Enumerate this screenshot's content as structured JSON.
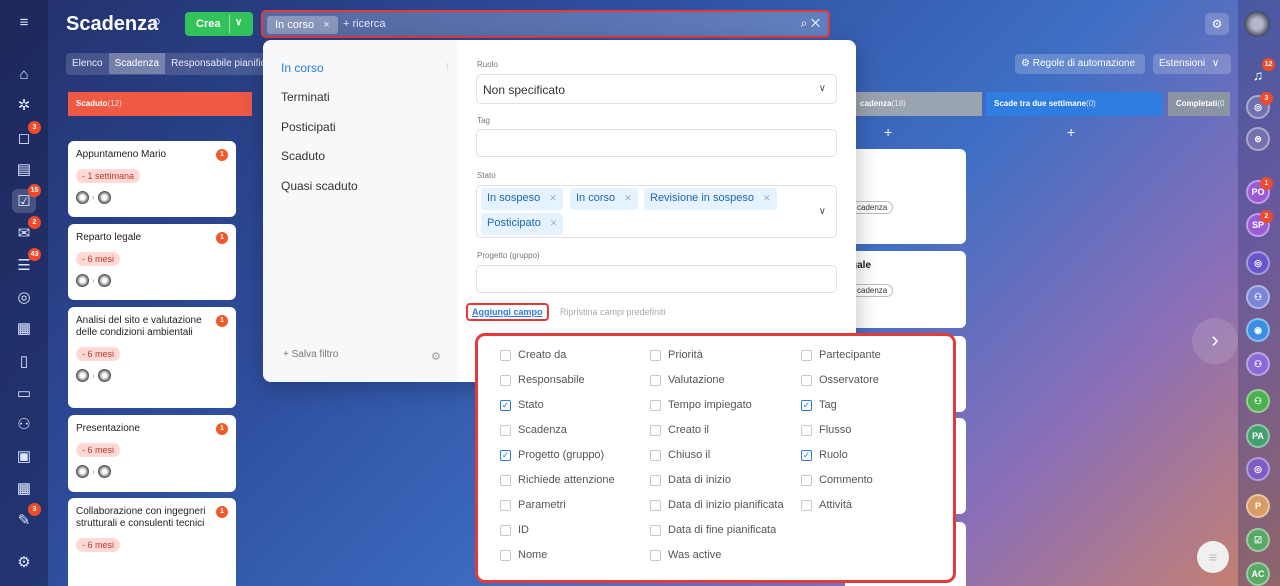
{
  "app_title": "Scadenza",
  "create_label": "Crea",
  "search": {
    "chip": "In corso",
    "placeholder": "+ ricerca"
  },
  "view_tabs": [
    "Elenco",
    "Scadenza",
    "Responsabile pianific"
  ],
  "automation_label": "Regole di automazione",
  "extensions_label": "Estensioni",
  "columns": [
    {
      "name": "Scaduto",
      "count": "(12)",
      "color": "#ef5a45"
    },
    {
      "name": "cadenza",
      "count": "(18)",
      "color": "#9aa3b0"
    },
    {
      "name": "Scade tra due settimane",
      "count": "(0)",
      "color": "#2f7de1"
    },
    {
      "name": "Completati",
      "count": "(0",
      "color": "#8a94a3"
    }
  ],
  "cards": [
    {
      "title": "Appuntameno Mario",
      "badge": "1",
      "deadline": "- 1 settimana"
    },
    {
      "title": "Reparto legale",
      "badge": "1",
      "deadline": "- 6 mesi"
    },
    {
      "title": "Analisi del sito e valutazione delle condizioni ambientali",
      "badge": "1",
      "deadline": "- 6 mesi"
    },
    {
      "title": "Presentazione",
      "badge": "1",
      "deadline": "- 6 mesi"
    },
    {
      "title": "Collaborazione con ingegneri strutturali e consulenti tecnici",
      "badge": "1",
      "deadline": "- 6 mesi"
    }
  ],
  "right_cards": [
    {
      "title": "",
      "pill": "cadenza"
    },
    {
      "title": "gale",
      "pill": "cadenza"
    }
  ],
  "presets": [
    "In corso",
    "Terminati",
    "Posticipati",
    "Scaduto",
    "Quasi scaduto"
  ],
  "save_filter": "+ Salva filtro",
  "filter_fields": {
    "ruolo_label": "Ruolo",
    "ruolo_value": "Non specificato",
    "tag_label": "Tag",
    "stato_label": "Stato",
    "stato_values": [
      "In sospeso",
      "In corso",
      "Revisione in sospeso",
      "Posticipato"
    ],
    "progetto_label": "Progetto (gruppo)"
  },
  "add_field": "Aggiungi campo",
  "reset_fields": "Ripristina campi predefiniti",
  "field_options": [
    [
      {
        "label": "Creato da",
        "checked": false
      },
      {
        "label": "Responsabile",
        "checked": false
      },
      {
        "label": "Stato",
        "checked": true
      },
      {
        "label": "Scadenza",
        "checked": false
      },
      {
        "label": "Progetto (gruppo)",
        "checked": true
      },
      {
        "label": "Richiede attenzione",
        "checked": false
      },
      {
        "label": "Parametri",
        "checked": false
      },
      {
        "label": "ID",
        "checked": false
      },
      {
        "label": "Nome",
        "checked": false
      }
    ],
    [
      {
        "label": "Priorità",
        "checked": false
      },
      {
        "label": "Valutazione",
        "checked": false
      },
      {
        "label": "Tempo impiegato",
        "checked": false
      },
      {
        "label": "Creato il",
        "checked": false
      },
      {
        "label": "Chiuso il",
        "checked": false
      },
      {
        "label": "Data di inizio",
        "checked": false
      },
      {
        "label": "Data di inizio pianificata",
        "checked": false
      },
      {
        "label": "Data di fine pianificata",
        "checked": false
      },
      {
        "label": "Was active",
        "checked": false
      }
    ],
    [
      {
        "label": "Partecipante",
        "checked": false
      },
      {
        "label": "Osservatore",
        "checked": false
      },
      {
        "label": "Tag",
        "checked": true
      },
      {
        "label": "Flusso",
        "checked": false
      },
      {
        "label": "Ruolo",
        "checked": true
      },
      {
        "label": "Commento",
        "checked": false
      },
      {
        "label": "Attività",
        "checked": false
      }
    ]
  ],
  "left_badges": {
    "chat": "3",
    "tasks": "15",
    "mail": "2",
    "feed": "43",
    "sign": "3"
  },
  "right_badges": {
    "bell": "12",
    "copilot": "3",
    "po": "1",
    "sp": "2"
  },
  "right_avatars": [
    "PO",
    "SP",
    "PA",
    "P",
    "AC"
  ]
}
